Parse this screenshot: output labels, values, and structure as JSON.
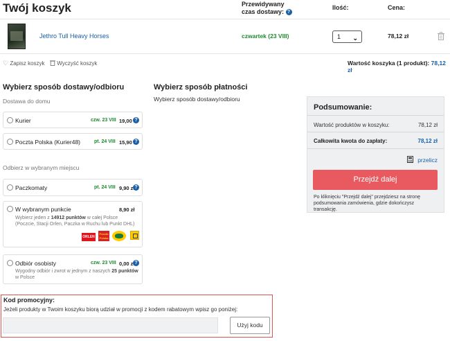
{
  "cart": {
    "title": "Twój koszyk",
    "col_delivery_time": "Przewidywany czas dostawy:",
    "col_qty": "Ilość:",
    "col_price": "Cena:"
  },
  "product": {
    "name": "Jethro Tull Heavy Horses",
    "delivery": "czwartek (23 VIII)",
    "qty": "1",
    "price": "78,12 zł"
  },
  "actions": {
    "save": "Zapisz koszyk",
    "clear": "Wyczyść koszyk"
  },
  "cart_value": {
    "label": "Wartość koszyka (1 produkt):",
    "value": "78,12 zł"
  },
  "delivery": {
    "title": "Wybierz sposób dostawy/odbioru",
    "home_label": "Dostawa do domu",
    "pickup_label": "Odbierz w wybranym miejscu",
    "options": [
      {
        "name": "Kurier",
        "date": "czw. 23 VIII",
        "price": "19,00 zł"
      },
      {
        "name": "Poczta Polska (Kurier48)",
        "date": "pt. 24 VIII",
        "price": "15,90 zł"
      },
      {
        "name": "Paczkomaty",
        "date": "pt. 24 VIII",
        "price": "9,90 zł"
      },
      {
        "name": "W wybranym punkcie",
        "date": "",
        "price": "8,90 zł",
        "desc_prefix": "Wybierz jeden z ",
        "desc_bold": "14912 punktów",
        "desc_suffix": " w całej Polsce",
        "desc_line2": "(Poczcie, Stacji Orlen, Paczka w Ruchu lub Punkt DHL)"
      },
      {
        "name": "Odbiór osobisty",
        "date": "czw. 23 VIII",
        "price": "0,00 zł",
        "desc_prefix": "Wygodny odbiór i zwrot w jednym z naszych ",
        "desc_bold": "25 punktów",
        "desc_line2": "w Polsce"
      }
    ],
    "logos": {
      "orlen": "ORLEN",
      "pp": "Poczta Polska"
    }
  },
  "payment": {
    "title": "Wybierz sposób płatności",
    "hint": "Wybierz sposób dostawy/odbioru"
  },
  "summary": {
    "title": "Podsumowanie:",
    "products_label": "Wartość produktów w koszyku:",
    "products_value": "78,12 zł",
    "total_label": "Całkowita kwota do zapłaty:",
    "total_value": "78,12 zł",
    "recalc": "przelicz",
    "cta": "Przejdź dalej",
    "note": "Po kliknięciu \"Przejdź dalej\" przejdziesz na stronę podsumowania zamówienia, gdzie dokończysz transakcję."
  },
  "promo": {
    "title": "Kod promocyjny:",
    "desc": "Jeżeli produkty w Twoim koszyku biorą udział w promocji z kodem rabatowym wpisz go poniżej:",
    "input_value": "",
    "button": "Użyj kodu"
  },
  "colors": {
    "accent_blue": "#1a5fa8",
    "date_green": "#1e8a2e",
    "cta_red": "#e85a5f",
    "promo_border": "#e2524f"
  }
}
